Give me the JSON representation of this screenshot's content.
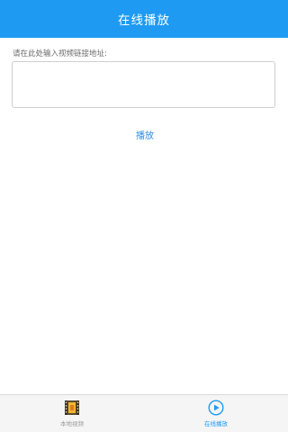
{
  "header": {
    "title": "在线播放"
  },
  "form": {
    "prompt": "请在此处输入视频链接地址:",
    "url_value": "",
    "play_label": "播放"
  },
  "tabbar": {
    "tabs": [
      {
        "label": "本地视频",
        "icon": "film-folder-icon",
        "active": false
      },
      {
        "label": "在线播放",
        "icon": "play-circle-icon",
        "active": true
      }
    ]
  },
  "colors": {
    "accent": "#1e9af3",
    "link": "#2a8de8",
    "inactive_tab": "#9a9a9a"
  }
}
